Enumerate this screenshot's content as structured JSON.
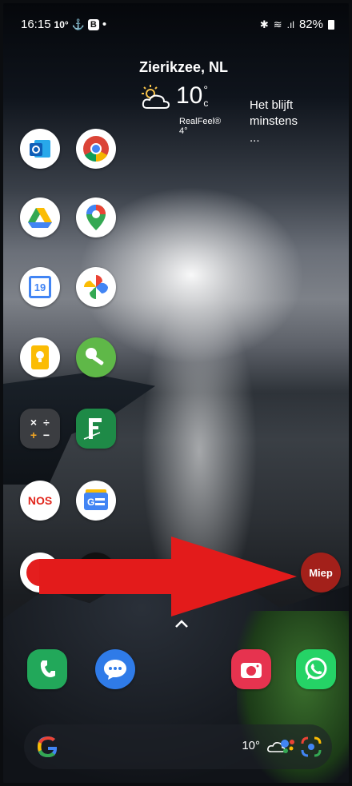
{
  "status": {
    "time": "16:15",
    "temp": "10°",
    "b_badge": "B",
    "battery": "82%"
  },
  "weather": {
    "city": "Zierikzee, NL",
    "temp": "10",
    "deg": "°",
    "unit": "c",
    "realfeel": "RealFeel® 4°",
    "forecast_l1": "Het blijft",
    "forecast_l2": "minstens ..."
  },
  "apps_left": [
    {
      "name": "outlook"
    },
    {
      "name": "chrome"
    },
    {
      "name": "drive"
    },
    {
      "name": "maps"
    },
    {
      "name": "calendar"
    },
    {
      "name": "photos"
    },
    {
      "name": "keep"
    },
    {
      "name": "key"
    },
    {
      "name": "calculator"
    },
    {
      "name": "feedly"
    },
    {
      "name": "nos"
    },
    {
      "name": "news"
    }
  ],
  "miep": {
    "label": "Miep"
  },
  "nos": {
    "label": "NOS"
  },
  "calendar": {
    "day": "19"
  },
  "search": {
    "temp": "10°"
  },
  "colors": {
    "arrow": "#e31b1b",
    "miep": "#a3201a",
    "phone": "#22a85a",
    "messages": "#2f7be8",
    "camera": "#e6334f",
    "whatsapp": "#25d366"
  }
}
